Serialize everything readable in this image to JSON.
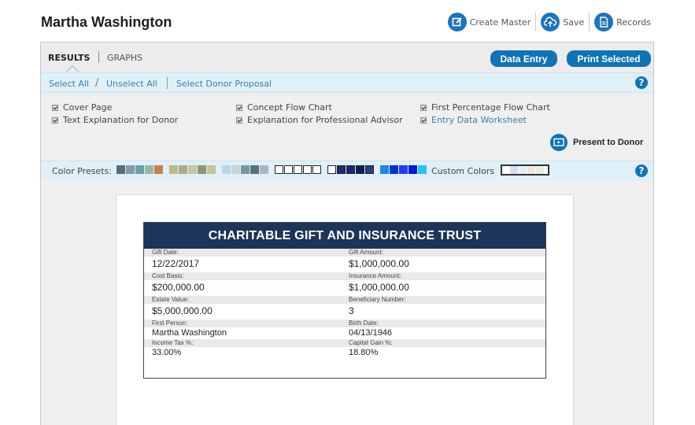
{
  "header": {
    "client_name": "Martha Washington",
    "actions": [
      {
        "label": "Create Master",
        "icon": "edit-icon"
      },
      {
        "label": "Save",
        "icon": "cloud-upload-icon"
      },
      {
        "label": "Records",
        "icon": "document-icon"
      }
    ]
  },
  "tabs": [
    {
      "label": "RESULTS",
      "active": true
    },
    {
      "label": "GRAPHS",
      "active": false
    }
  ],
  "buttons": {
    "data_entry": "Data Entry",
    "print_selected": "Print Selected"
  },
  "select_bar": {
    "select_all": "Select All",
    "separator": "/",
    "unselect_all": "Unselect All",
    "select_donor_proposal": "Select Donor Proposal",
    "help": "?"
  },
  "checkboxes": [
    {
      "label": "Cover Page",
      "checked": true
    },
    {
      "label": "Text Explanation for Donor",
      "checked": true
    },
    {
      "label": "Concept Flow Chart",
      "checked": true
    },
    {
      "label": "Explanation for Professional Advisor",
      "checked": true
    },
    {
      "label": "First Percentage Flow Chart",
      "checked": true
    },
    {
      "label": "Entry Data Worksheet",
      "checked": true
    }
  ],
  "present_to_donor": "Present to Donor",
  "colors": {
    "label": "Color Presets:",
    "custom_label": "Custom Colors",
    "help": "?",
    "accent": "#0f73b6",
    "presets": [
      [
        "#5a6b7b",
        "#7f9aa8",
        "#6aa0a8",
        "#9ab7a5",
        "#c8804f"
      ],
      [
        "#b9bd82",
        "#a8ab86",
        "#c7c59b",
        "#8f9676",
        "#c2c39c"
      ],
      [
        "#b7d7ea",
        "#c5d4da",
        "#7895a1",
        "#56717f",
        "#aab8bd"
      ],
      [
        "#ffffff",
        "#ffffff",
        "#ffffff",
        "#ffffff",
        "#ffffff"
      ],
      [
        "#ffffff",
        "#1c2d6e",
        "#1a237e",
        "#0d1b5e",
        "#2a3f7f"
      ],
      [
        "#1e88e5",
        "#0033cc",
        "#1e3cff",
        "#0018d9",
        "#25c4f0"
      ]
    ],
    "custom": [
      "#d7dcef",
      "#e8eef3",
      "#efe6e3",
      "#e6eee2"
    ]
  },
  "report": {
    "title": "CHARITABLE GIFT AND INSURANCE TRUST",
    "header_color": "#1c3558",
    "rows": [
      {
        "l1": "Gift Date:",
        "v1": "12/22/2017",
        "l2": "Gift Amount:",
        "v2": "$1,000,000.00"
      },
      {
        "l1": "Cost Basis:",
        "v1": "$200,000.00",
        "l2": "Insurance Amount:",
        "v2": "$1,000,000.00"
      },
      {
        "l1": "Estate Value:",
        "v1": "$5,000,000.00",
        "l2": "Beneficiary Number:",
        "v2": "3"
      },
      {
        "l1": "First Person:",
        "v1": "Martha Washington",
        "l2": "Birth Date:",
        "v2": "04/13/1946"
      },
      {
        "l1": "Income Tax %:",
        "v1": "33.00%",
        "l2": "Capital Gain %:",
        "v2": "18.80%"
      }
    ]
  }
}
